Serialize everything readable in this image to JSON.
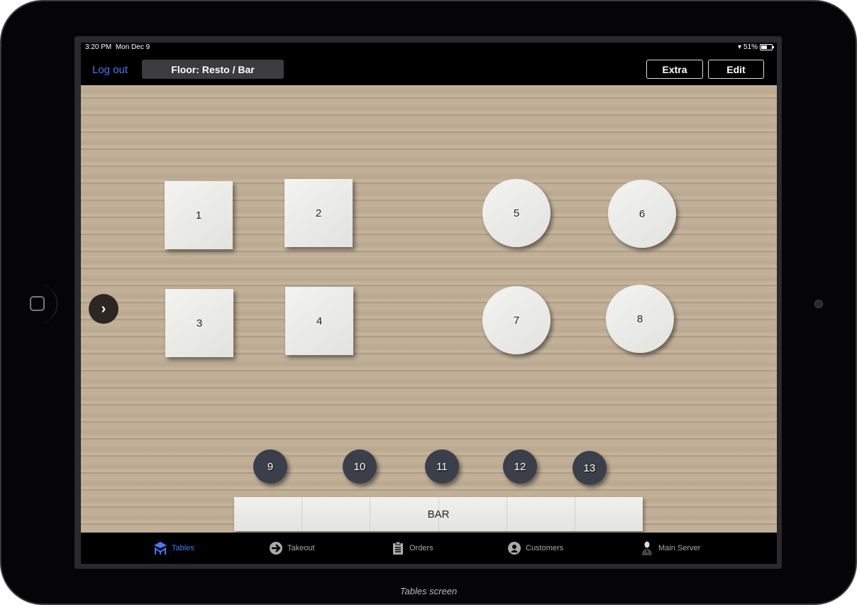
{
  "status_bar": {
    "time": "3:20 PM",
    "date": "Mon Dec 9",
    "battery": "51%"
  },
  "header": {
    "logout": "Log out",
    "floor": "Floor: Resto / Bar",
    "extra": "Extra",
    "edit": "Edit"
  },
  "tables": {
    "square": [
      "1",
      "2",
      "3",
      "4"
    ],
    "round": [
      "5",
      "6",
      "7",
      "8"
    ],
    "small": [
      "9",
      "10",
      "11",
      "12",
      "13"
    ],
    "bar": "BAR"
  },
  "tabbar": {
    "items": [
      {
        "label": "Tables",
        "icon": "tables-icon",
        "active": true
      },
      {
        "label": "Takeout",
        "icon": "arrow-right-circle-icon"
      },
      {
        "label": "Orders",
        "icon": "clipboard-icon"
      },
      {
        "label": "Customers",
        "icon": "person-circle-icon"
      },
      {
        "label": "Main Server",
        "icon": "server-person-icon"
      }
    ]
  },
  "caption": "Tables screen",
  "colors": {
    "accent": "#4a78f0",
    "small_table": "#3a3f4a",
    "floor_wood": "#c4b39b"
  }
}
